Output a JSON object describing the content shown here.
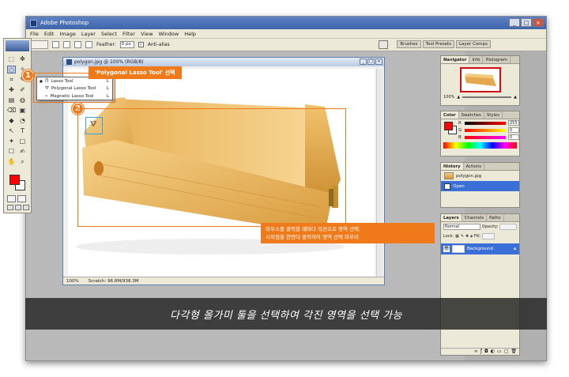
{
  "app": {
    "title": "Adobe Photoshop",
    "window_controls": [
      "_",
      "□",
      "×"
    ]
  },
  "menu": [
    "File",
    "Edit",
    "Image",
    "Layer",
    "Select",
    "Filter",
    "View",
    "Window",
    "Help"
  ],
  "options_bar": {
    "feather_label": "Feather:",
    "feather_value": "0 px",
    "antialias_label": "Anti-alias",
    "antialias_checked": "✓"
  },
  "palette_well_tabs": [
    "Brushes",
    "Tool Presets",
    "Layer Comps"
  ],
  "toolbox": {
    "tools": [
      "⬚",
      "✥",
      "◌",
      "✧",
      "⌗",
      "✎",
      "✚",
      "✐",
      "▤",
      "◍",
      "⌫",
      "▣",
      "◆",
      "◔",
      "↖",
      "T",
      "✦",
      "□",
      "☐",
      "✍",
      "✋",
      "⌕"
    ],
    "fg_color": "#ff0000",
    "bg_color": "#ffffff"
  },
  "flyout": [
    {
      "label": "Lasso Tool",
      "key": "L",
      "icon": "lasso-icon",
      "glyph": "ᑎ"
    },
    {
      "label": "Polygonal Lasso Tool",
      "key": "L",
      "icon": "polygonal-lasso-icon",
      "glyph": "⛛"
    },
    {
      "label": "Magnetic Lasso Tool",
      "key": "L",
      "icon": "magnetic-lasso-icon",
      "glyph": "⌁"
    }
  ],
  "document": {
    "title": "polygon.jpg @ 100% (RGB/8)",
    "zoom": "100%",
    "scratch": "Scratch: 96.8M/938.3M"
  },
  "navigator": {
    "tabs": [
      "Navigator",
      "Info",
      "Histogram"
    ],
    "zoom": "100%"
  },
  "color_panel": {
    "tabs": [
      "Color",
      "Swatches",
      "Styles"
    ],
    "channels": [
      {
        "label": "R",
        "value": "255"
      },
      {
        "label": "G",
        "value": "0"
      },
      {
        "label": "B",
        "value": "0"
      }
    ]
  },
  "history": {
    "tabs": [
      "History",
      "Actions"
    ],
    "snapshot": "polygon.jpg",
    "step": "Open"
  },
  "layers": {
    "tabs": [
      "Layers",
      "Channels",
      "Paths"
    ],
    "blend_mode": "Normal",
    "opacity_label": "Opacity:",
    "fill_label": "Fill:",
    "lock_label": "Lock:",
    "layer_name": "Background"
  },
  "annotations": {
    "badge1": "1",
    "badge2": "2",
    "step1_label": "'Polygonal Lasso Tool' 선택",
    "step2_line1": "마우스를 클릭할 때마다 직선으로 영역 선택.",
    "step2_line2": "시작점을 한번더 클릭하여 영역 선택 마무리"
  },
  "caption": "다각형 올가미 툴을 선택하여 각진 영역을 선택 가능",
  "accent_color": "#f07a1a"
}
